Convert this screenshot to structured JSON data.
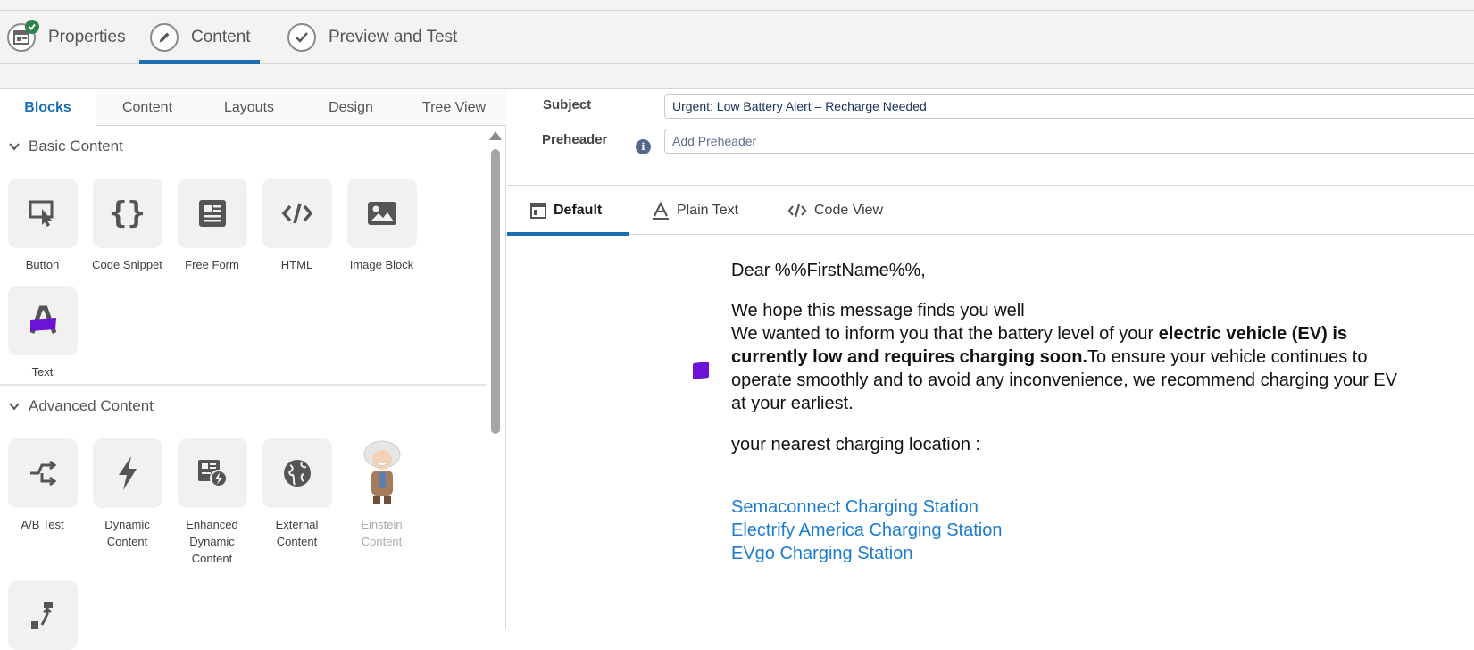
{
  "steps": [
    {
      "label": "Properties",
      "icon": "properties-icon",
      "completed": true
    },
    {
      "label": "Content",
      "icon": "pencil-icon",
      "active": true
    },
    {
      "label": "Preview and Test",
      "icon": "checkmark-icon"
    }
  ],
  "left": {
    "tabs": [
      "Blocks",
      "Content",
      "Layouts",
      "Design",
      "Tree View"
    ],
    "basic": {
      "heading": "Basic Content",
      "blocks": [
        {
          "label": "Button",
          "icon": "button-cursor-icon"
        },
        {
          "label": "Code Snippet",
          "icon": "curly-braces-icon"
        },
        {
          "label": "Free Form",
          "icon": "free-form-icon"
        },
        {
          "label": "HTML",
          "icon": "code-icon"
        },
        {
          "label": "Image Block",
          "icon": "image-icon"
        },
        {
          "label": "Text",
          "icon": "text-icon"
        }
      ]
    },
    "advanced": {
      "heading": "Advanced Content",
      "blocks": [
        {
          "label": "A/B Test",
          "icon": "ab-test-icon"
        },
        {
          "label": "Dynamic Content",
          "icon": "lightning-icon"
        },
        {
          "label": "Enhanced Dynamic Content",
          "icon": "enhanced-dynamic-icon"
        },
        {
          "label": "External Content",
          "icon": "globe-icon"
        },
        {
          "label": "Einstein Content",
          "icon": "einstein-icon"
        }
      ]
    }
  },
  "right": {
    "subject_label": "Subject",
    "subject_value": "Urgent: Low Battery Alert – Recharge Needed",
    "preheader_label": "Preheader",
    "preheader_placeholder": "Add Preheader",
    "view_tabs": [
      "Default",
      "Plain Text",
      "Code View"
    ],
    "email": {
      "greeting": "Dear %%FirstName%%,",
      "line1": "We hope this message finds you well",
      "line2_start": "We wanted to inform you that the battery level of your ",
      "line2_bold": "electric vehicle (EV) is currently low and requires charging soon.",
      "line2_end": "To ensure your vehicle continues to operate smoothly and to avoid any inconvenience, we recommend charging your EV at your earliest.",
      "location_intro": "your nearest charging location :",
      "links": [
        "Semaconnect Charging Station",
        "Electrify America Charging Station",
        "EVgo Charging Station"
      ]
    }
  },
  "colors": {
    "accent": "#1b6eb3",
    "link": "#1b7bd0",
    "success": "#2e844a",
    "marker": "#6b14d6"
  }
}
